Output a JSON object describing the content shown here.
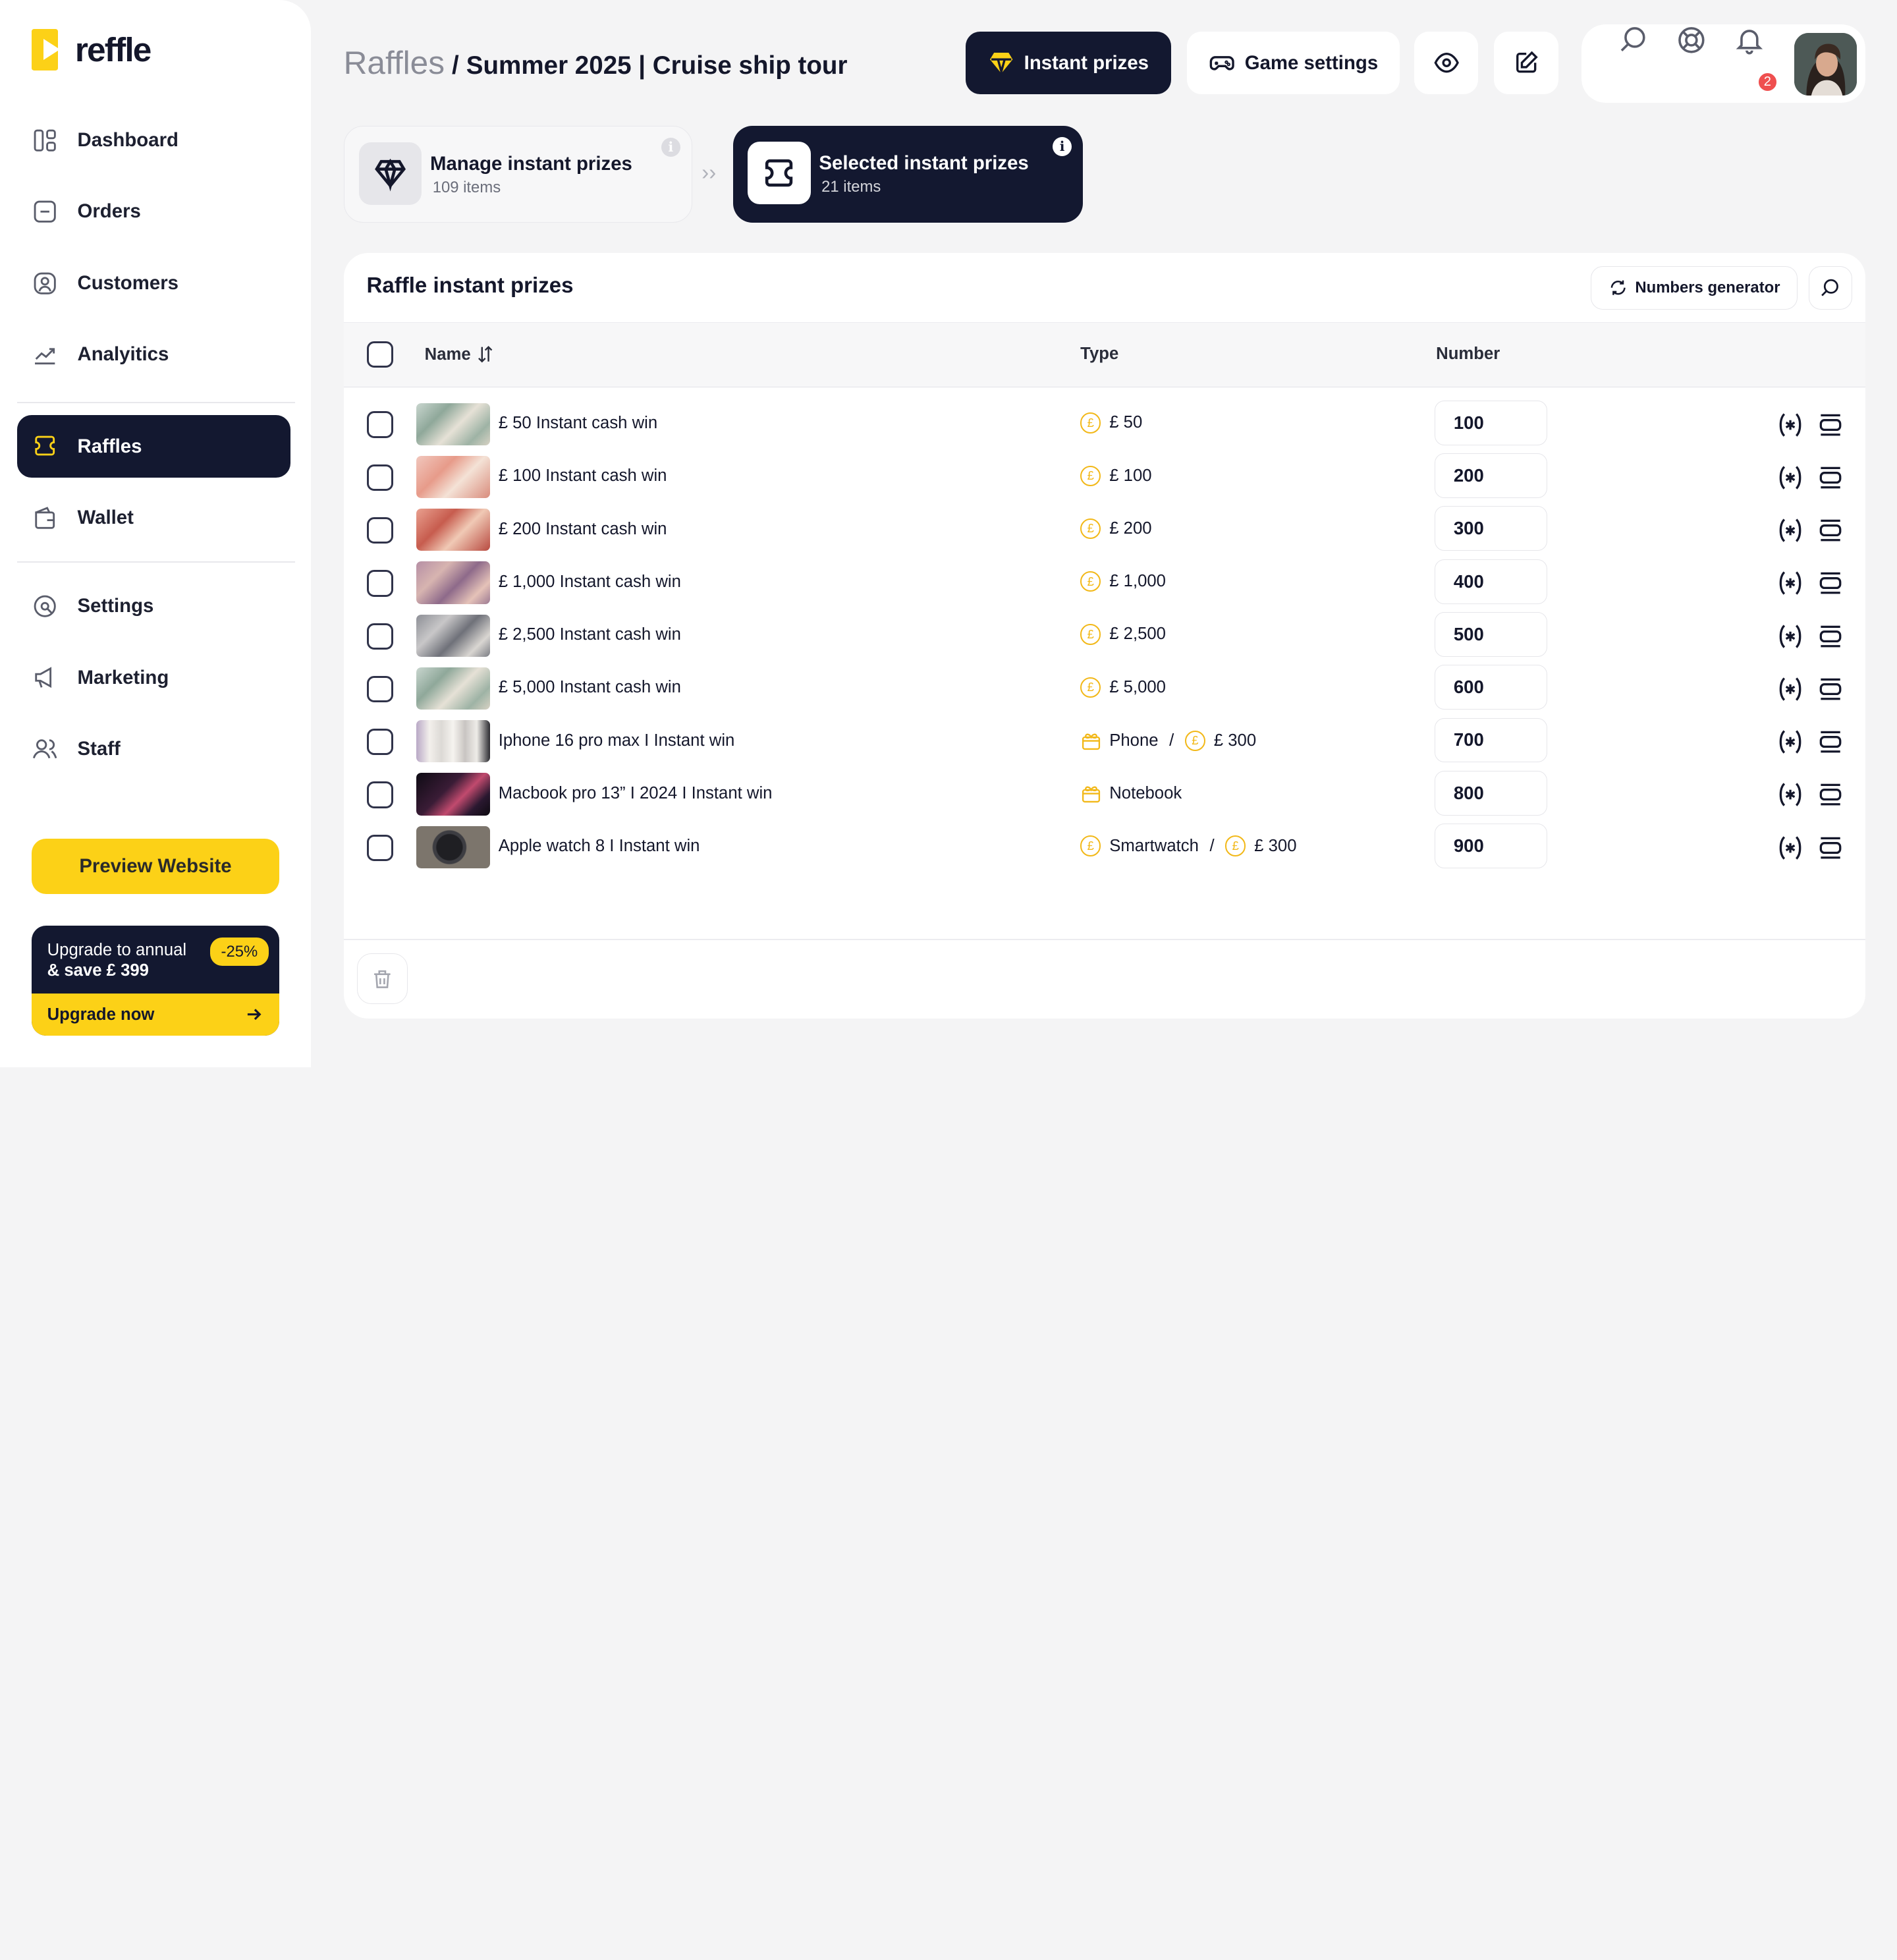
{
  "brand": {
    "name": "reffle",
    "accent": "#fcd117",
    "dark": "#131830"
  },
  "sidebar": {
    "items": [
      {
        "label": "Dashboard",
        "icon": "dashboard-icon"
      },
      {
        "label": "Orders",
        "icon": "orders-icon"
      },
      {
        "label": "Customers",
        "icon": "customers-icon"
      },
      {
        "label": "Analyitics",
        "icon": "analytics-icon"
      },
      {
        "label": "Raffles",
        "icon": "ticket-icon",
        "active": true
      },
      {
        "label": "Wallet",
        "icon": "wallet-icon"
      },
      {
        "label": "Settings",
        "icon": "settings-icon"
      },
      {
        "label": "Marketing",
        "icon": "megaphone-icon"
      },
      {
        "label": "Staff",
        "icon": "staff-icon"
      }
    ],
    "preview_label": "Preview Website",
    "upgrade": {
      "line1": "Upgrade to annual",
      "line2": "& save £ 399",
      "discount": "-25%",
      "cta": "Upgrade now"
    }
  },
  "header": {
    "breadcrumb_root": "Raffles",
    "breadcrumb_sep": "/",
    "page_title": "Summer 2025 | Cruise ship tour",
    "instant_prizes_label": "Instant prizes",
    "game_settings_label": "Game settings",
    "notification_count": "2"
  },
  "steps": [
    {
      "title": "Manage instant prizes",
      "sub": "109 items"
    },
    {
      "title": "Selected instant prizes",
      "sub": "21 items"
    }
  ],
  "card": {
    "title": "Raffle instant prizes",
    "generator_label": "Numbers generator",
    "columns": {
      "name": "Name",
      "type": "Type",
      "number": "Number"
    },
    "rows": [
      {
        "name": "£ 50 Instant cash win",
        "type": [
          {
            "icon": "coin-icon",
            "text": "£ 50"
          }
        ],
        "number": "100",
        "thumb": "cash"
      },
      {
        "name": "£ 100 Instant cash win",
        "type": [
          {
            "icon": "coin-icon",
            "text": "£ 100"
          }
        ],
        "number": "200",
        "thumb": "cash-pink"
      },
      {
        "name": "£ 200 Instant cash win",
        "type": [
          {
            "icon": "coin-icon",
            "text": "£ 200"
          }
        ],
        "number": "300",
        "thumb": "cash-red"
      },
      {
        "name": "£ 1,000 Instant cash win",
        "type": [
          {
            "icon": "coin-icon",
            "text": "£ 1,000"
          }
        ],
        "number": "400",
        "thumb": "cash-purple"
      },
      {
        "name": "£ 2,500 Instant cash win",
        "type": [
          {
            "icon": "coin-icon",
            "text": "£ 2,500"
          }
        ],
        "number": "500",
        "thumb": "cash-grey"
      },
      {
        "name": "£ 5,000 Instant cash win",
        "type": [
          {
            "icon": "coin-icon",
            "text": "£ 5,000"
          }
        ],
        "number": "600",
        "thumb": "cash"
      },
      {
        "name": "Iphone 16 pro max I Instant win",
        "type": [
          {
            "icon": "gift-icon",
            "text": "Phone"
          },
          {
            "icon": "coin-icon",
            "text": "£ 300"
          }
        ],
        "number": "700",
        "thumb": "phones"
      },
      {
        "name": "Macbook pro 13” I 2024 I Instant win",
        "type": [
          {
            "icon": "gift-icon",
            "text": "Notebook"
          }
        ],
        "number": "800",
        "thumb": "laptop"
      },
      {
        "name": "Apple watch 8 I Instant win",
        "type": [
          {
            "icon": "coin-icon",
            "text": "Smartwatch"
          },
          {
            "icon": "coin-icon",
            "text": "£ 300"
          }
        ],
        "number": "900",
        "thumb": "watch"
      }
    ]
  }
}
